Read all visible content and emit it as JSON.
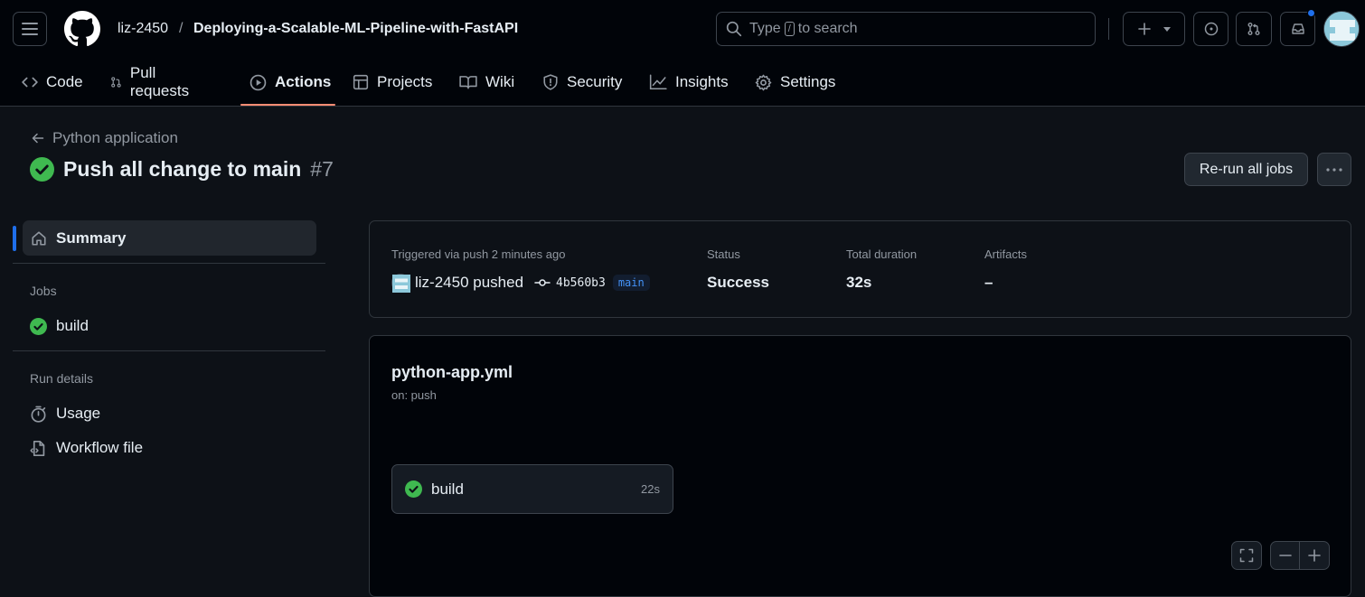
{
  "header": {
    "owner": "liz-2450",
    "separator": "/",
    "repo": "Deploying-a-Scalable-ML-Pipeline-with-FastAPI",
    "search_prefix": "Type",
    "search_key": "/",
    "search_suffix": "to search"
  },
  "tabs": [
    {
      "label": "Code",
      "icon": "code-icon"
    },
    {
      "label": "Pull requests",
      "icon": "git-pull-request-icon"
    },
    {
      "label": "Actions",
      "icon": "play-icon",
      "active": true
    },
    {
      "label": "Projects",
      "icon": "table-icon"
    },
    {
      "label": "Wiki",
      "icon": "book-icon"
    },
    {
      "label": "Security",
      "icon": "shield-icon"
    },
    {
      "label": "Insights",
      "icon": "graph-icon"
    },
    {
      "label": "Settings",
      "icon": "gear-icon"
    }
  ],
  "run": {
    "back_label": "Python application",
    "title": "Push all change to main",
    "number": "#7",
    "rerun_label": "Re-run all jobs"
  },
  "sidebar": {
    "summary_label": "Summary",
    "jobs_heading": "Jobs",
    "job_label": "build",
    "details_heading": "Run details",
    "usage_label": "Usage",
    "workflow_file_label": "Workflow file"
  },
  "summary": {
    "triggered": "Triggered via push 2 minutes ago",
    "pusher": "liz-2450 pushed",
    "sha": "4b560b3",
    "branch": "main",
    "status_label": "Status",
    "status_value": "Success",
    "duration_label": "Total duration",
    "duration_value": "32s",
    "artifacts_label": "Artifacts",
    "artifacts_value": "–"
  },
  "graph": {
    "workflow_file": "python-app.yml",
    "trigger": "on: push",
    "job_name": "build",
    "job_duration": "22s"
  },
  "colors": {
    "success": "#238636",
    "accent": "#1f6feb",
    "tab_underline": "#fd8c73"
  }
}
